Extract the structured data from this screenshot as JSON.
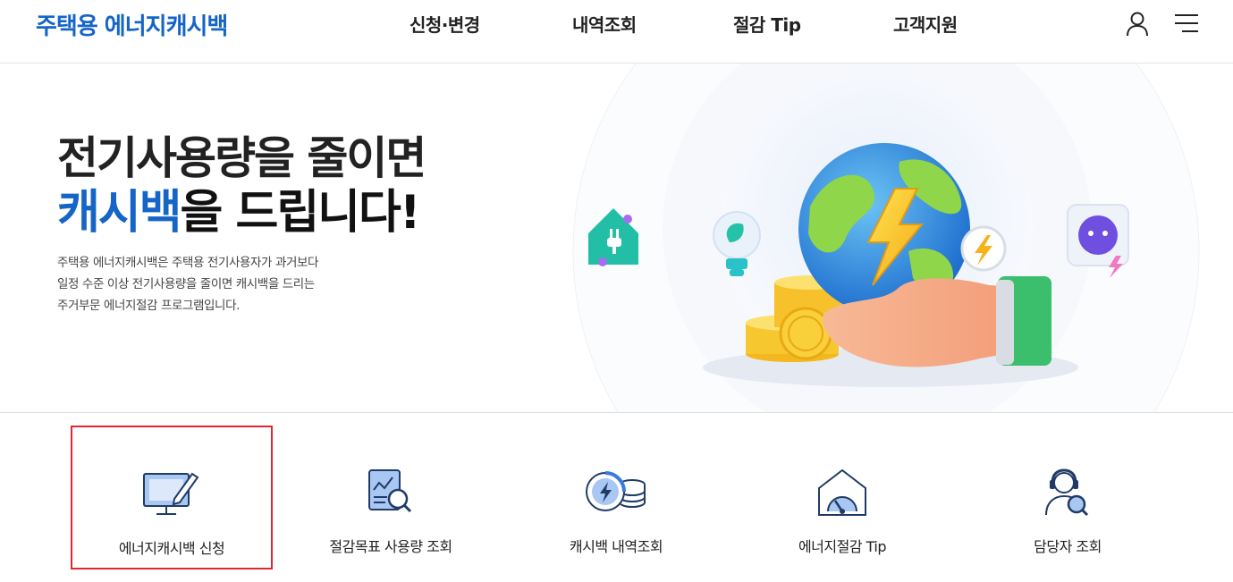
{
  "header": {
    "logo": "주택용 에너지캐시백",
    "nav": [
      "신청·변경",
      "내역조회",
      "절감 Tip",
      "고객지원"
    ],
    "user_icon": "user-icon",
    "menu_icon": "hamburger-menu-icon"
  },
  "hero": {
    "title_line1": "전기사용량을 줄이면",
    "title_line2_accent": "캐시백",
    "title_line2_rest": "을 드립니다!",
    "desc_lines": [
      "주택용 에너지캐시백은 주택용 전기사용자가 과거보다",
      "일정 수준 이상 전기사용량을 줄이면 캐시백을 드리는",
      "주거부문 에너지절감 프로그램입니다."
    ]
  },
  "services": [
    {
      "label": "에너지캐시백 신청",
      "icon": "monitor-pen-icon",
      "selected": true
    },
    {
      "label": "절감목표 사용량 조회",
      "icon": "report-search-icon",
      "selected": false
    },
    {
      "label": "캐시백 내역조회",
      "icon": "coin-bolt-icon",
      "selected": false
    },
    {
      "label": "에너지절감 Tip",
      "icon": "house-gauge-icon",
      "selected": false
    },
    {
      "label": "담당자 조회",
      "icon": "support-agent-search-icon",
      "selected": false
    }
  ],
  "colors": {
    "brand": "#1565c7",
    "selected_border": "#e0282f",
    "icon_blue": "#1565c7",
    "icon_light": "#a9c7f3"
  }
}
